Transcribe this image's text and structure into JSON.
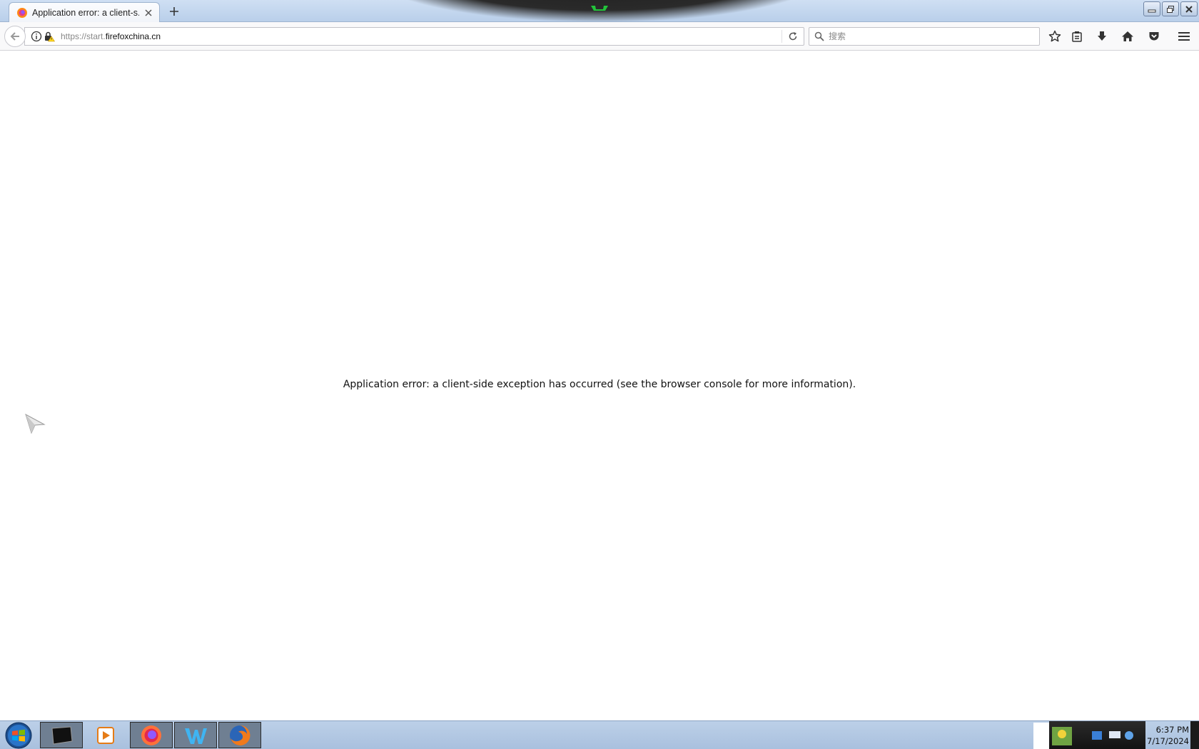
{
  "browser": {
    "tab": {
      "title": "Application error: a client-s..."
    },
    "url": {
      "scheme_path": "https://start.",
      "domain": "firefoxchina.cn"
    },
    "search": {
      "placeholder": "搜索"
    }
  },
  "content": {
    "error_message": "Application error: a client-side exception has occurred (see the browser console for more information)."
  },
  "taskbar": {
    "clock": {
      "time": "6:37 PM",
      "date": "7/17/2024"
    },
    "apps": [
      "terminal-icon",
      "media-player-icon",
      "firefox-icon",
      "w-app-icon",
      "firefox-icon"
    ]
  },
  "colors": {
    "tab_bg": "#f3f6fb",
    "toolbar_bg": "#f9f9fa",
    "taskbar_bg": "#b5c9e4",
    "notch_led": "#22c43a"
  }
}
